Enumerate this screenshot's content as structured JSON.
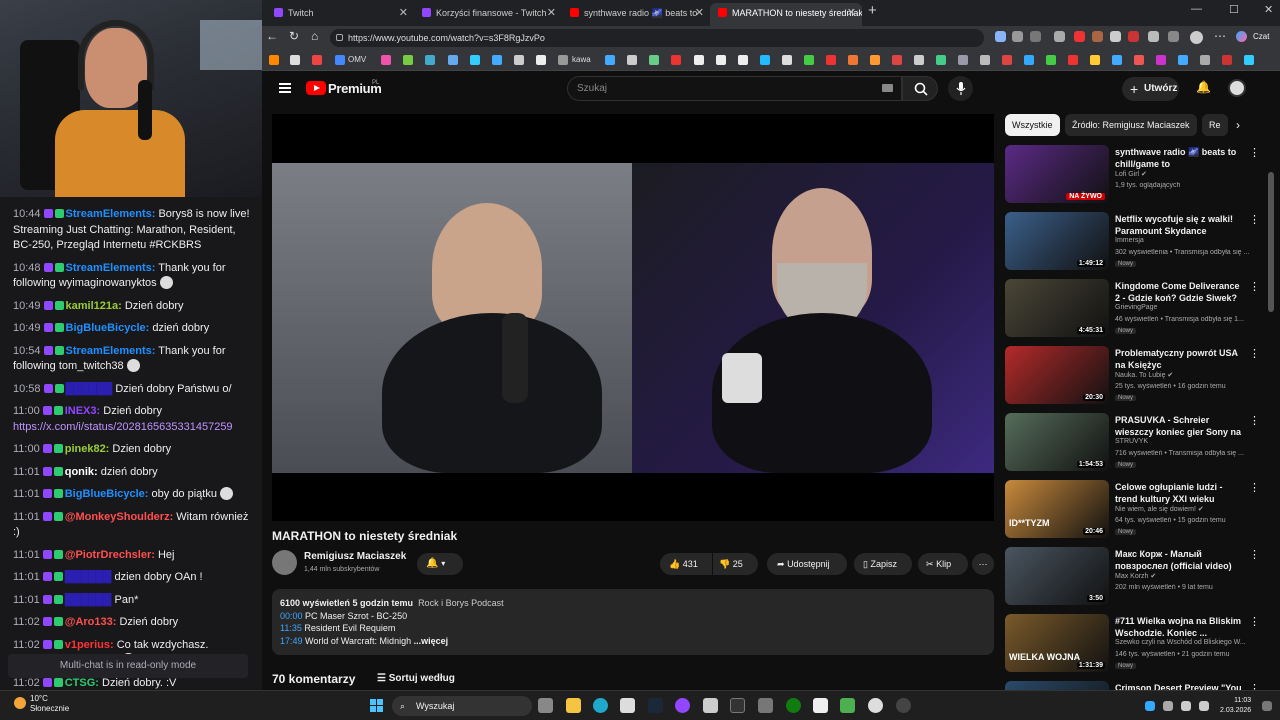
{
  "colors": {
    "bg": "#0f0f0f",
    "chat_bg": "#18181b",
    "youtube_red": "#ff0000",
    "link_blue": "#3ea6ff",
    "twitch_purple": "#9147ff"
  },
  "chat": {
    "messages": [
      {
        "time": "10:44",
        "user": "StreamElements:",
        "user_color": "#1e90ff",
        "text": " Borys8 is now live! Streaming Just Chatting: Marathon, Resident, BC-250, Przegląd Internetu #RCKBRS"
      },
      {
        "time": "10:48",
        "user": "StreamElements:",
        "user_color": "#1e90ff",
        "text": " Thank you for following wyimaginowanyktos",
        "emote": true
      },
      {
        "time": "10:49",
        "user": "kamil121a:",
        "user_color": "#9acd32",
        "text": " Dzień dobry"
      },
      {
        "time": "10:49",
        "user": "BigBlueBicycle:",
        "user_color": "#1e90ff",
        "text": " dzień dobry"
      },
      {
        "time": "10:54",
        "user": "StreamElements:",
        "user_color": "#1e90ff",
        "text": " Thank you for following tom_twitch38",
        "emote": true
      },
      {
        "time": "10:58",
        "user": "",
        "user_color": "#2a1fb0",
        "text": " Dzień dobry Państwu o/"
      },
      {
        "time": "11:00",
        "user": "INEX3:",
        "user_color": "#9147ff",
        "text": " Dzień dobry",
        "link": "https://x.com/i/status/2028165635331457259"
      },
      {
        "time": "11:00",
        "user": "pinek82:",
        "user_color": "#9acd32",
        "text": " Dzien dobry"
      },
      {
        "time": "11:01",
        "user": "qonik:",
        "user_color": "#ffffff",
        "text": " dzień dobry"
      },
      {
        "time": "11:01",
        "user": "BigBlueBicycle:",
        "user_color": "#1e90ff",
        "text": " oby do piątku",
        "emote": true
      },
      {
        "time": "11:01",
        "user": "@MonkeyShoulderz:",
        "user_color": "#ff4f4f",
        "text": " Witam również :)"
      },
      {
        "time": "11:01",
        "user": "@PiotrDrechsler:",
        "user_color": "#ff4f4f",
        "text": " Hej"
      },
      {
        "time": "11:01",
        "user": "",
        "user_color": "#2a1fb0",
        "text": " dzien dobry OAn !"
      },
      {
        "time": "11:01",
        "user": "",
        "user_color": "#2a1fb0",
        "text": " Pan*"
      },
      {
        "time": "11:02",
        "user": "@Aro133:",
        "user_color": "#ff4f4f",
        "text": " Dzień dobry"
      },
      {
        "time": "11:02",
        "user": "v1perius:",
        "user_color": "#ff3333",
        "text": " Co tak wzdychasz. Biegałeś po zasilacz?",
        "emote": true
      },
      {
        "time": "11:02",
        "user": "CTSG:",
        "user_color": "#2ecc71",
        "text": " Dzień dobry. :V"
      }
    ],
    "readonly": "Multi-chat is in read-only mode"
  },
  "browser": {
    "tabs": [
      {
        "label": "Twitch",
        "icon": "twitch-icon"
      },
      {
        "label": "Korzyści finansowe - Twitch",
        "icon": "twitch-icon"
      },
      {
        "label": "synthwave radio 🌌 beats to",
        "icon": "youtube-icon"
      },
      {
        "label": "MARATHON to niestety średniak",
        "icon": "youtube-icon"
      }
    ],
    "url": "https://www.youtube.com/watch?v=s3F8RgJzvPo",
    "bookmarks": [
      "OMV",
      "kawa"
    ],
    "profile": "Czat"
  },
  "youtube": {
    "brand": "Premium",
    "brand_region": "PL",
    "search_placeholder": "Szukaj",
    "create_label": "Utwórz",
    "video_title": "MARATHON to niestety średniak",
    "channel_name": "Remigiusz Maciaszek",
    "channel_subs": "1,44 mln subskrybentów",
    "likes": "431",
    "dislikes": "25",
    "share": "Udostępnij",
    "save": "Zapisz",
    "clip": "Klip",
    "desc_stats": "6100 wyświetleń  5 godzin temu",
    "desc_tags": "Rock i Borys Podcast",
    "chapters": [
      {
        "time": "00:00",
        "label": "PC Maser Szrot - BC-250"
      },
      {
        "time": "11:35",
        "label": "Resident Evil Requiem"
      },
      {
        "time": "17:49",
        "label": "World of Warcraft: Midnigh"
      }
    ],
    "more": "...więcej",
    "comments": "70 komentarzy",
    "sort": "Sortuj według",
    "chips": [
      "Wszystkie",
      "Źródło: Remigiusz Maciaszek",
      "Re"
    ],
    "recommendations": [
      {
        "title": "synthwave radio 🌌 beats to chill/game to",
        "channel": "Lofi Girl ✔",
        "meta": "1,9 tys. oglądających",
        "badge": "NA ŻYWO",
        "new": "",
        "thumb": "#5b2a86"
      },
      {
        "title": "Netflix wycofuje się z walki! Paramount Skydance przejmuj...",
        "channel": "Immersja",
        "meta": "302 wyświetlenia • Transmisja odbyła się ...",
        "badge": "1:49:12",
        "new": "Nowy",
        "thumb": "#3b5f8a"
      },
      {
        "title": "Kingdome Come Deliverance 2 - Gdzie koń? Gdzie Siwek?",
        "channel": "GrievingPage",
        "meta": "46 wyświetleń • Transmisja odbyła się 1...",
        "badge": "4:45:31",
        "new": "Nowy",
        "thumb": "#4a4637"
      },
      {
        "title": "Problematyczny powrót USA na Księżyc",
        "channel": "Nauka. To Lubię ✔",
        "meta": "25 tys. wyświetleń • 16 godzin temu",
        "badge": "20:30",
        "new": "Nowy",
        "thumb": "#b52a2a"
      },
      {
        "title": "PRASUVKA - Schreier wieszczy koniec gier Sony na PC",
        "channel": "STRUVYK",
        "meta": "716 wyświetleń • Transmisja odbyła się ...",
        "badge": "1:54:53",
        "new": "Nowy",
        "thumb": "#566d5a"
      },
      {
        "title": "Celowe ogłupianie ludzi - trend kultury XXI wieku",
        "channel": "Nie wiem, ale się dowiem! ✔",
        "meta": "64 tys. wyświetleń • 15 godzin temu",
        "badge": "20:46",
        "new": "Nowy",
        "thumb": "#c98a3c",
        "thumb_text": "ID**TYZM"
      },
      {
        "title": "Макс Корж - Малый повзрослел (official video)",
        "channel": "Max Korzh ✔",
        "meta": "202 mln wyświetleń • 9 lat temu",
        "badge": "3:50",
        "new": "",
        "thumb": "#4a5560"
      },
      {
        "title": "#711 Wielka wojna na Bliskim Wschodzie. Koniec ...",
        "channel": "Szewko czyli na Wschód od Bliskiego W...",
        "meta": "146 tys. wyświetleń • 21 godzin temu",
        "badge": "1:31:39",
        "new": "Nowy",
        "thumb": "#7a5a2a",
        "thumb_text": "WIELKA WOJNA"
      },
      {
        "title": "Crimson Desert Preview \"You",
        "channel": "",
        "meta": "",
        "badge": "",
        "new": "",
        "thumb": "#2a4a6a"
      }
    ]
  },
  "taskbar": {
    "weather_temp": "10°C",
    "weather_desc": "Słonecznie",
    "search": "Wyszukaj",
    "time": "11:03",
    "date": "2.03.2026"
  }
}
